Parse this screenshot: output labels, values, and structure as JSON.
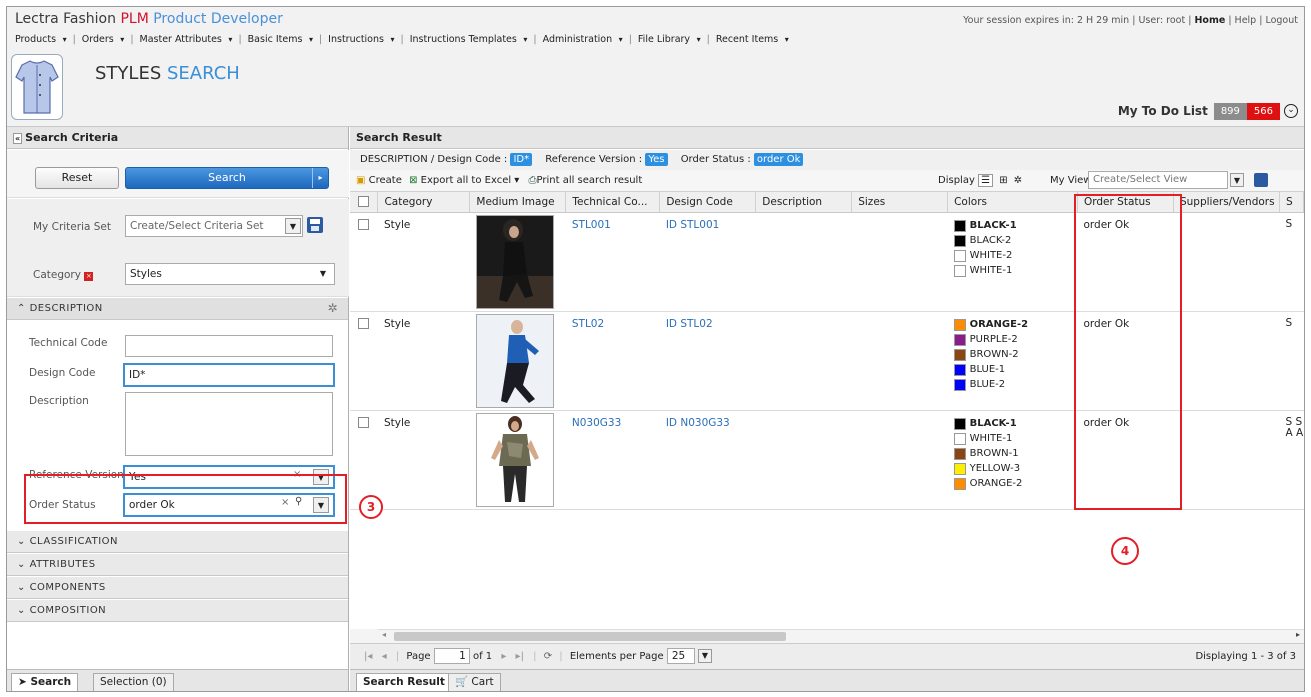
{
  "app": {
    "brand_a": "Lectra",
    "brand_b": "Fashion",
    "brand_c": "PLM",
    "brand_d": "Product Developer",
    "session": "Your session expires in: 2 H 29 min",
    "user_label": "User:",
    "user": "root",
    "home": "Home",
    "help": "Help",
    "logout": "Logout"
  },
  "menu": [
    "Products",
    "Orders",
    "Master Attributes",
    "Basic Items",
    "Instructions",
    "Instructions Templates",
    "Administration",
    "File Library",
    "Recent Items"
  ],
  "page": {
    "title_a": "STYLES",
    "title_b": "SEARCH"
  },
  "todo": {
    "label": "My To Do List",
    "count_a": "899",
    "count_b": "566"
  },
  "left": {
    "header": "Search Criteria",
    "reset": "Reset",
    "search": "Search",
    "criteria_set_label": "My Criteria Set",
    "criteria_set_placeholder": "Create/Select Criteria Set",
    "category_label": "Category",
    "category_value": "Styles",
    "section_description": "DESCRIPTION",
    "technical_code_label": "Technical Code",
    "technical_code_value": "",
    "design_code_label": "Design Code",
    "design_code_value": "ID*",
    "description_label": "Description",
    "reference_version_label": "Reference Version",
    "reference_version_value": "Yes",
    "order_status_label": "Order Status",
    "order_status_value": "order Ok",
    "sections": [
      "CLASSIFICATION",
      "ATTRIBUTES",
      "COMPONENTS",
      "COMPOSITION"
    ],
    "tab_search": "Search",
    "tab_selection": "Selection (0)"
  },
  "right": {
    "header": "Search Result",
    "criteria": {
      "desc_label": "DESCRIPTION / Design Code :",
      "desc_value": "ID*",
      "ref_label": "Reference Version :",
      "ref_value": "Yes",
      "status_label": "Order Status :",
      "status_value": "order Ok"
    },
    "toolbar": {
      "create": "Create",
      "export": "Export all to Excel",
      "print": "Print all search result",
      "display": "Display",
      "myviews": "My Views",
      "views_placeholder": "Create/Select View"
    },
    "columns": [
      "Category",
      "Medium Image",
      "Technical Co...",
      "Design Code",
      "Description",
      "Sizes",
      "Colors",
      "Order Status",
      "Suppliers/Vendors",
      "S"
    ],
    "rows": [
      {
        "category": "Style",
        "technical": "STL001",
        "design": "ID STL001",
        "status": "order Ok",
        "extra": "S",
        "colors": [
          {
            "name": "BLACK-1",
            "hex": "#000000",
            "bold": true
          },
          {
            "name": "BLACK-2",
            "hex": "#000000"
          },
          {
            "name": "WHITE-2",
            "hex": "#ffffff"
          },
          {
            "name": "WHITE-1",
            "hex": "#ffffff"
          }
        ]
      },
      {
        "category": "Style",
        "technical": "STL02",
        "design": "ID STL02",
        "status": "order Ok",
        "extra": "S",
        "colors": [
          {
            "name": "ORANGE-2",
            "hex": "#ff8c00",
            "bold": true
          },
          {
            "name": "PURPLE-2",
            "hex": "#8b1a8b"
          },
          {
            "name": "BROWN-2",
            "hex": "#8b4513"
          },
          {
            "name": "BLUE-1",
            "hex": "#0000ff"
          },
          {
            "name": "BLUE-2",
            "hex": "#0000ff"
          }
        ]
      },
      {
        "category": "Style",
        "technical": "N030G33",
        "design": "ID N030G33",
        "status": "order Ok",
        "extra": "S S A A",
        "colors": [
          {
            "name": "BLACK-1",
            "hex": "#000000",
            "bold": true
          },
          {
            "name": "WHITE-1",
            "hex": "#ffffff"
          },
          {
            "name": "BROWN-1",
            "hex": "#8b4513"
          },
          {
            "name": "YELLOW-3",
            "hex": "#ffee00"
          },
          {
            "name": "ORANGE-2",
            "hex": "#ff8c00"
          }
        ]
      }
    ],
    "pager": {
      "page_label": "Page",
      "page_value": "1",
      "of": "of 1",
      "per_page_label": "Elements per Page",
      "per_page_value": "25",
      "displaying": "Displaying 1 - 3 of 3"
    },
    "tab_result": "Search Result",
    "tab_cart": "Cart"
  },
  "annotations": {
    "a3": "3",
    "a4": "4"
  }
}
